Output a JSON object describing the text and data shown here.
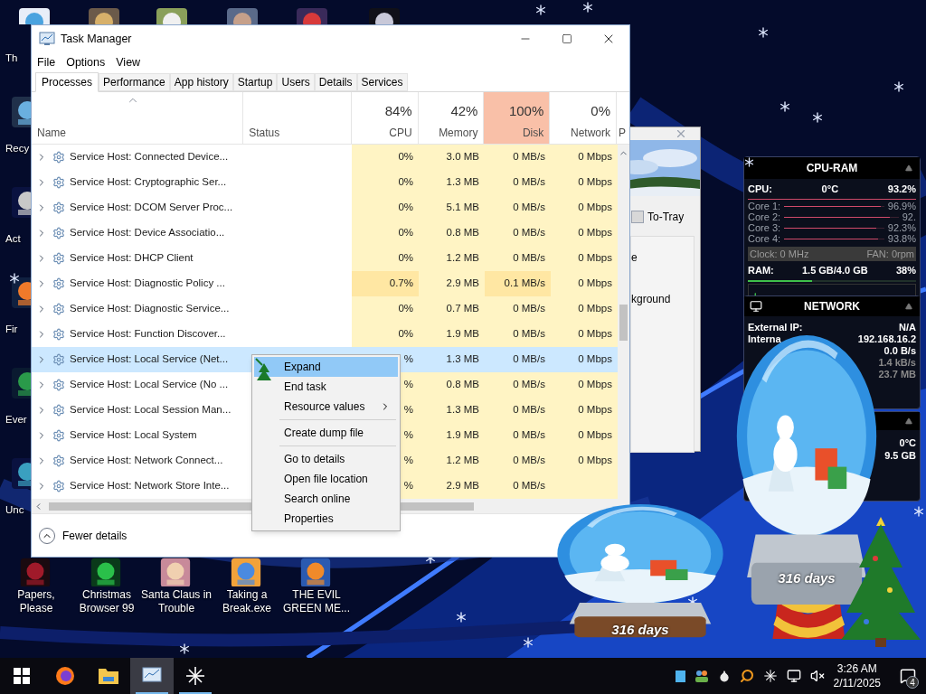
{
  "desktop_icons_left": [
    {
      "label": "Th"
    },
    {
      "label": "Recy"
    },
    {
      "label": "Act"
    },
    {
      "label": "Fir"
    },
    {
      "label": "Ever"
    },
    {
      "label": "Unc"
    }
  ],
  "desktop_icons_bottom": [
    {
      "label": "Papers, Please"
    },
    {
      "label": "Christmas Browser 99"
    },
    {
      "label": "Santa Claus in Trouble"
    },
    {
      "label": "Taking a Break.exe"
    },
    {
      "label": "THE EVIL GREEN ME..."
    }
  ],
  "background_window": {
    "button": "To-Tray",
    "texts": [
      "e",
      "kground"
    ]
  },
  "task_manager": {
    "title": "Task Manager",
    "menu": [
      "File",
      "Options",
      "View"
    ],
    "tabs": [
      {
        "label": "Processes",
        "selected": true
      },
      {
        "label": "Performance",
        "selected": false
      },
      {
        "label": "App history",
        "selected": false
      },
      {
        "label": "Startup",
        "selected": false
      },
      {
        "label": "Users",
        "selected": false
      },
      {
        "label": "Details",
        "selected": false
      },
      {
        "label": "Services",
        "selected": false
      }
    ],
    "columns": [
      {
        "kind": "name",
        "label": "Name"
      },
      {
        "kind": "status",
        "label": "Status"
      },
      {
        "kind": "metric",
        "usage": "84%",
        "label": "CPU",
        "hot": false
      },
      {
        "kind": "metric",
        "usage": "42%",
        "label": "Memory",
        "hot": false
      },
      {
        "kind": "metric",
        "usage": "100%",
        "label": "Disk",
        "hot": true
      },
      {
        "kind": "metric",
        "usage": "0%",
        "label": "Network",
        "hot": false
      },
      {
        "kind": "partial",
        "label": "P"
      }
    ],
    "rows": [
      {
        "name": "Service Host: Connected Device...",
        "values": [
          "0%",
          "3.0 MB",
          "0 MB/s",
          "0 Mbps"
        ],
        "busy": false,
        "selected": false
      },
      {
        "name": "Service Host: Cryptographic Ser...",
        "values": [
          "0%",
          "1.3 MB",
          "0 MB/s",
          "0 Mbps"
        ],
        "busy": false,
        "selected": false
      },
      {
        "name": "Service Host: DCOM Server Proc...",
        "values": [
          "0%",
          "5.1 MB",
          "0 MB/s",
          "0 Mbps"
        ],
        "busy": false,
        "selected": false
      },
      {
        "name": "Service Host: Device Associatio...",
        "values": [
          "0%",
          "0.8 MB",
          "0 MB/s",
          "0 Mbps"
        ],
        "busy": false,
        "selected": false
      },
      {
        "name": "Service Host: DHCP Client",
        "values": [
          "0%",
          "1.2 MB",
          "0 MB/s",
          "0 Mbps"
        ],
        "busy": false,
        "selected": false
      },
      {
        "name": "Service Host: Diagnostic Policy ...",
        "values": [
          "0.7%",
          "2.9 MB",
          "0.1 MB/s",
          "0 Mbps"
        ],
        "busy": true,
        "selected": false
      },
      {
        "name": "Service Host: Diagnostic Service...",
        "values": [
          "0%",
          "0.7 MB",
          "0 MB/s",
          "0 Mbps"
        ],
        "busy": false,
        "selected": false
      },
      {
        "name": "Service Host: Function Discover...",
        "values": [
          "0%",
          "1.9 MB",
          "0 MB/s",
          "0 Mbps"
        ],
        "busy": false,
        "selected": false
      },
      {
        "name": "Service Host: Local Service (Net...",
        "values": [
          "%",
          "1.3 MB",
          "0 MB/s",
          "0 Mbps"
        ],
        "busy": false,
        "selected": true
      },
      {
        "name": "Service Host: Local Service (No ...",
        "values": [
          "%",
          "0.8 MB",
          "0 MB/s",
          "0 Mbps"
        ],
        "busy": false,
        "selected": false
      },
      {
        "name": "Service Host: Local Session Man...",
        "values": [
          "%",
          "1.3 MB",
          "0 MB/s",
          "0 Mbps"
        ],
        "busy": false,
        "selected": false
      },
      {
        "name": "Service Host: Local System",
        "values": [
          "%",
          "1.9 MB",
          "0 MB/s",
          "0 Mbps"
        ],
        "busy": false,
        "selected": false
      },
      {
        "name": "Service Host: Network Connect...",
        "values": [
          "%",
          "1.2 MB",
          "0 MB/s",
          "0 Mbps"
        ],
        "busy": false,
        "selected": false
      },
      {
        "name": "Service Host: Network Store Inte...",
        "values": [
          "%",
          "2.9 MB",
          "0 MB/s"
        ],
        "busy": false,
        "selected": false
      }
    ],
    "footer": "Fewer details"
  },
  "context_menu": [
    {
      "kind": "item",
      "label": "Expand",
      "selected": true,
      "submenu": false
    },
    {
      "kind": "item",
      "label": "End task",
      "selected": false,
      "submenu": false
    },
    {
      "kind": "item",
      "label": "Resource values",
      "selected": false,
      "submenu": true
    },
    {
      "kind": "separator"
    },
    {
      "kind": "item",
      "label": "Create dump file",
      "selected": false,
      "submenu": false
    },
    {
      "kind": "separator"
    },
    {
      "kind": "item",
      "label": "Go to details",
      "selected": false,
      "submenu": false
    },
    {
      "kind": "item",
      "label": "Open file location",
      "selected": false,
      "submenu": false
    },
    {
      "kind": "item",
      "label": "Search online",
      "selected": false,
      "submenu": false
    },
    {
      "kind": "item",
      "label": "Properties",
      "selected": false,
      "submenu": false
    }
  ],
  "cpu_ram_gadget": {
    "title": "CPU-RAM",
    "cpu_label": "CPU:",
    "temperature": "0°C",
    "cpu_usage": "93.2%",
    "cores": [
      {
        "label": "Core 1:",
        "reading": "96.9%",
        "level": 0.97
      },
      {
        "label": "Core 2:",
        "reading": "92.",
        "level": 0.92
      },
      {
        "label": "Core 3:",
        "reading": "92.3%",
        "level": 0.92
      },
      {
        "label": "Core 4:",
        "reading": "93.8%",
        "level": 0.94
      }
    ],
    "clock": "Clock: 0 MHz",
    "fan": "FAN: 0rpm",
    "ram": {
      "label": "RAM:",
      "value": "1.5 GB/4.0 GB",
      "reading": "38%",
      "level": 0.38
    }
  },
  "network_gadget": {
    "title": "NETWORK",
    "rows": [
      {
        "label": "External IP:",
        "value": "N/A"
      },
      {
        "label": "Interna",
        "value": "192.168.16.2"
      },
      {
        "value": "0.0 B/s"
      },
      {
        "value": "1.4 kB/s"
      },
      {
        "value": "23.7 MB"
      }
    ]
  },
  "third_gadget": {
    "values": [
      "0°C",
      "9.5 GB"
    ]
  },
  "globes": [
    {
      "counter": "316 days"
    },
    {
      "counter": "316 days"
    }
  ],
  "taskbar": {
    "apps": [
      {
        "kind": "firefox",
        "running": false,
        "active": false
      },
      {
        "kind": "folder",
        "running": false,
        "active": false
      },
      {
        "kind": "taskmgr",
        "running": true,
        "active": true
      },
      {
        "kind": "asterisk",
        "running": true,
        "active": false
      }
    ],
    "time": "3:26 AM",
    "date": "2/11/2025",
    "notifications": "4"
  }
}
